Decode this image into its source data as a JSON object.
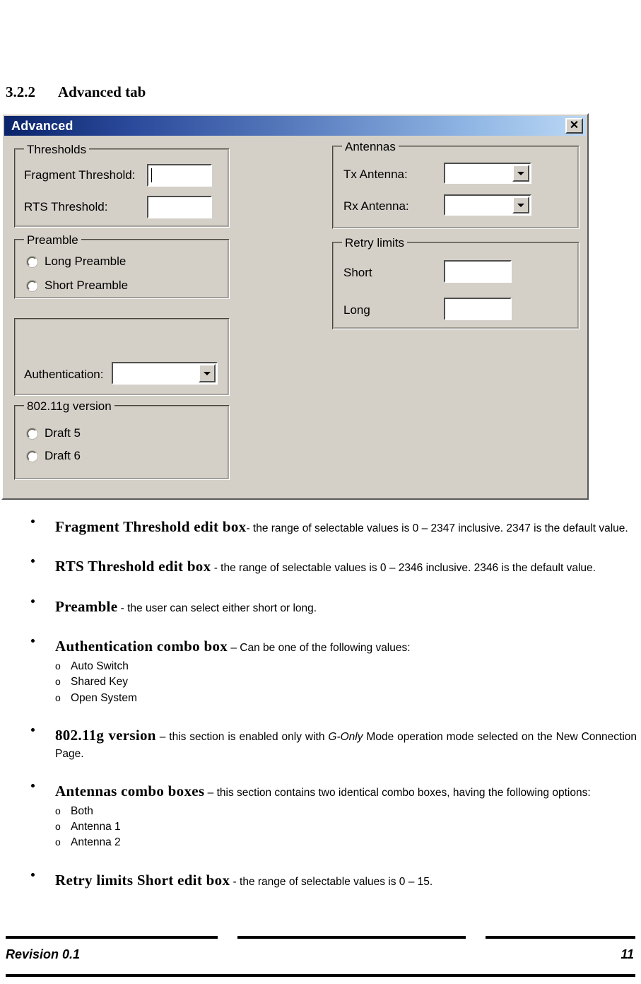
{
  "document": {
    "section_number": "3.2.2",
    "section_title": "Advanced tab"
  },
  "dialog": {
    "title": "Advanced",
    "close_label": "✕",
    "groups": {
      "thresholds": {
        "title": "Thresholds",
        "fragment_label": "Fragment Threshold:",
        "fragment_value": "",
        "rts_label": "RTS Threshold:",
        "rts_value": ""
      },
      "preamble": {
        "title": "Preamble",
        "options": [
          {
            "label": "Long Preamble",
            "selected": false
          },
          {
            "label": "Short Preamble",
            "selected": false
          }
        ]
      },
      "authentication": {
        "title": "",
        "label": "Authentication:",
        "value": ""
      },
      "version": {
        "title": "802.11g version",
        "options": [
          {
            "label": "Draft 5",
            "selected": false
          },
          {
            "label": "Draft 6",
            "selected": false
          }
        ]
      },
      "antennas": {
        "title": "Antennas",
        "tx_label": "Tx Antenna:",
        "tx_value": "",
        "rx_label": "Rx Antenna:",
        "rx_value": ""
      },
      "retry": {
        "title": "Retry limits",
        "short_label": "Short",
        "short_value": "",
        "long_label": "Long",
        "long_value": ""
      }
    }
  },
  "bullets": [
    {
      "term": "Fragment Threshold edit box",
      "rest": "- the range of selectable values is 0 – 2347 inclusive. 2347 is the default value.",
      "subitems": []
    },
    {
      "term": "RTS Threshold edit box",
      "rest": " - the range of selectable values is 0 – 2346 inclusive. 2346 is the default value.",
      "subitems": []
    },
    {
      "term": "Preamble",
      "rest": " - the user can select either short or long.",
      "subitems": []
    },
    {
      "term": "Authentication combo box",
      "rest": " – Can be one of the following values:",
      "subitems": [
        "Auto Switch",
        "Shared Key",
        "Open System"
      ]
    },
    {
      "term": "802.11g version",
      "rest_pre": " – this section is enabled only with ",
      "rest_italic": "G-Only",
      "rest_post": " Mode operation mode selected on the New Connection Page.",
      "subitems": []
    },
    {
      "term": "Antennas combo boxes",
      "rest": " – this section contains two identical combo boxes, having the following options:",
      "subitems": [
        "Both",
        "Antenna 1",
        "Antenna 2"
      ]
    },
    {
      "term": "Retry limits Short edit box",
      "rest": " - the range of selectable values is 0 – 15.",
      "subitems": []
    }
  ],
  "footer": {
    "revision": "Revision 0.1",
    "page_number": "11"
  },
  "bullet_marker": "o",
  "colors": {
    "title_gradient_start": "#0a246a",
    "title_gradient_end": "#bcd8f5",
    "dialog_face": "#d4d0c8"
  }
}
